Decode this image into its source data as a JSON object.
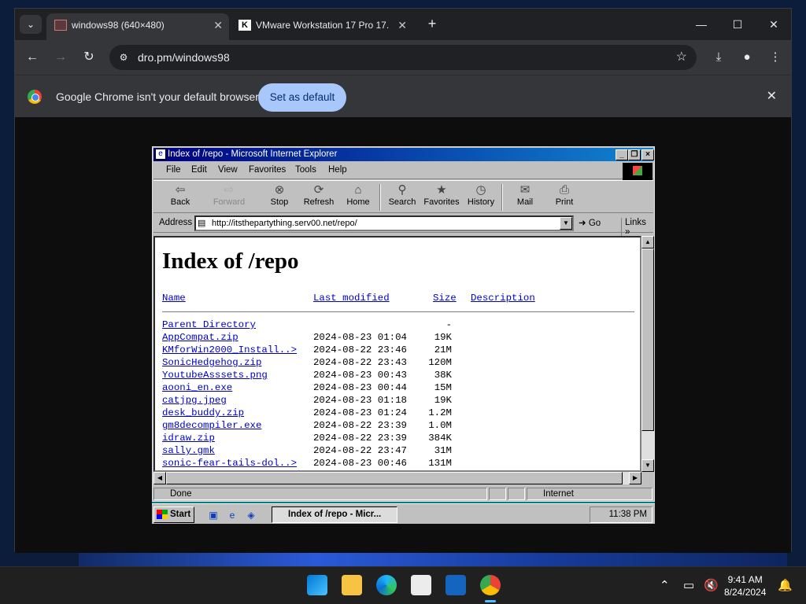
{
  "browser": {
    "tabs": [
      {
        "title": "windows98 (640×480)",
        "active": true
      },
      {
        "title": "VMware Workstation 17 Pro 17.",
        "active": false
      }
    ],
    "url": "dro.pm/windows98",
    "infobar": {
      "message": "Google Chrome isn't your default browser",
      "button": "Set as default"
    }
  },
  "ie": {
    "title": "Index of /repo - Microsoft Internet Explorer",
    "menu": [
      "File",
      "Edit",
      "View",
      "Favorites",
      "Tools",
      "Help"
    ],
    "toolbar": [
      "Back",
      "Forward",
      "Stop",
      "Refresh",
      "Home",
      "Search",
      "Favorites",
      "History",
      "Mail",
      "Print"
    ],
    "address_label": "Address",
    "address": "http://itsthepartything.serv00.net/repo/",
    "go": "Go",
    "links": "Links",
    "status": "Done",
    "zone": "Internet"
  },
  "listing": {
    "heading": "Index of /repo",
    "columns": {
      "name": "Name",
      "modified": "Last modified",
      "size": "Size",
      "description": "Description"
    },
    "rows": [
      {
        "name": "Parent Directory",
        "date": "",
        "size": "-"
      },
      {
        "name": "AppCompat.zip",
        "date": "2024-08-23 01:04",
        "size": "19K"
      },
      {
        "name": "KMforWin2000_Install..>",
        "date": "2024-08-22 23:46",
        "size": "21M"
      },
      {
        "name": "SonicHedgehog.zip",
        "date": "2024-08-22 23:43",
        "size": "120M"
      },
      {
        "name": "YoutubeAsssets.png",
        "date": "2024-08-23 00:43",
        "size": "38K"
      },
      {
        "name": "aooni_en.exe",
        "date": "2024-08-23 00:44",
        "size": "15M"
      },
      {
        "name": "catjpg.jpeg",
        "date": "2024-08-23 01:18",
        "size": "19K"
      },
      {
        "name": "desk_buddy.zip",
        "date": "2024-08-23 01:24",
        "size": "1.2M"
      },
      {
        "name": "gm8decompiler.exe",
        "date": "2024-08-22 23:39",
        "size": "1.0M"
      },
      {
        "name": "idraw.zip",
        "date": "2024-08-22 23:39",
        "size": "384K"
      },
      {
        "name": "sally.gmk",
        "date": "2024-08-22 23:47",
        "size": "31M"
      },
      {
        "name": "sonic-fear-tails-dol..>",
        "date": "2024-08-23 00:46",
        "size": "131M"
      }
    ]
  },
  "w98taskbar": {
    "start": "Start",
    "task": "Index of /repo - Micr...",
    "time": "11:38 PM"
  },
  "win11": {
    "time": "9:41 AM",
    "date": "8/24/2024",
    "accent": "#4cc2ff"
  }
}
